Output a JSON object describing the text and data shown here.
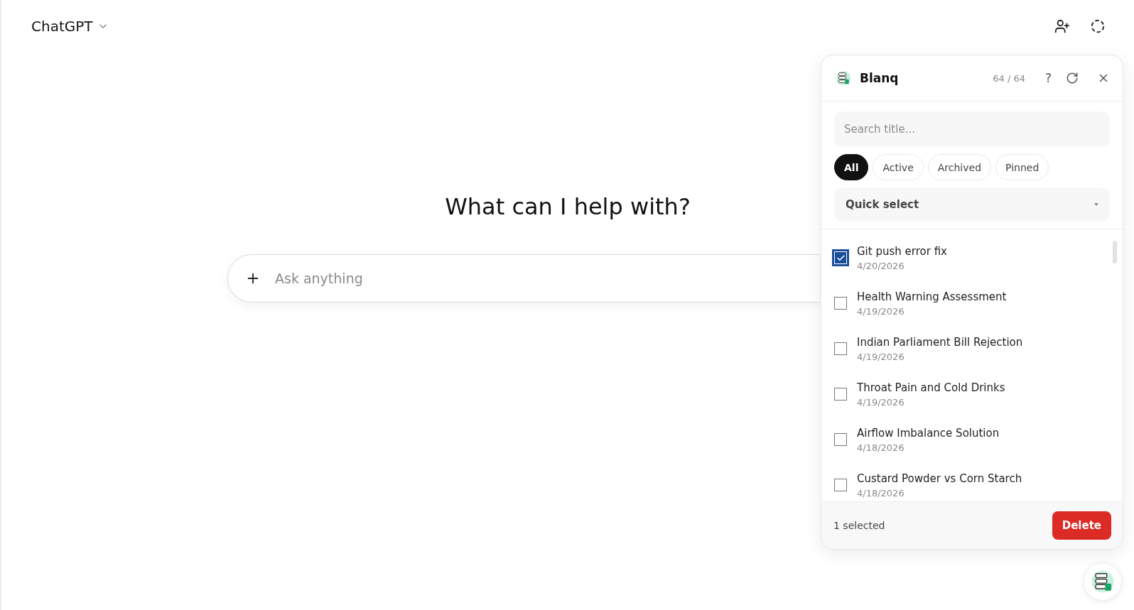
{
  "header": {
    "title": "ChatGPT"
  },
  "main": {
    "heading": "What can I help with?",
    "composer": {
      "placeholder": "Ask anything"
    }
  },
  "panel": {
    "title": "Blanq",
    "count": "64 / 64",
    "help": "?",
    "search": {
      "placeholder": "Search title..."
    },
    "filters": [
      {
        "label": "All",
        "selected": true
      },
      {
        "label": "Active",
        "selected": false
      },
      {
        "label": "Archived",
        "selected": false
      },
      {
        "label": "Pinned",
        "selected": false
      }
    ],
    "quick_select": {
      "value": "Quick select"
    },
    "items": [
      {
        "title": "Git push error fix",
        "date": "4/20/2026",
        "checked": true
      },
      {
        "title": "Health Warning Assessment",
        "date": "4/19/2026",
        "checked": false
      },
      {
        "title": "Indian Parliament Bill Rejection",
        "date": "4/19/2026",
        "checked": false
      },
      {
        "title": "Throat Pain and Cold Drinks",
        "date": "4/19/2026",
        "checked": false
      },
      {
        "title": "Airflow Imbalance Solution",
        "date": "4/18/2026",
        "checked": false
      },
      {
        "title": "Custard Powder vs Corn Starch",
        "date": "4/18/2026",
        "checked": false
      }
    ],
    "footer": {
      "status": "1 selected",
      "delete": "Delete"
    }
  }
}
